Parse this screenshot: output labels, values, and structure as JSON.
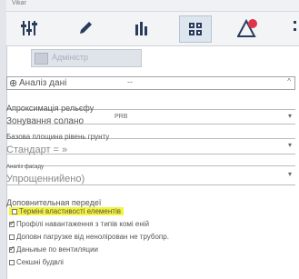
{
  "window": {
    "title": "Vikar"
  },
  "toolbar": {
    "active_index": 3,
    "icons": [
      "sliders-icon",
      "pencil-icon",
      "bar-chart-icon",
      "grid-icon",
      "warning-badge-icon"
    ]
  },
  "banner": {
    "label": "Адміністр"
  },
  "analysis": {
    "value": "Аналіз дані",
    "sub": "--"
  },
  "relief": {
    "label": "Апроксимація рельєфу"
  },
  "zoning": {
    "label": "Зонування солано",
    "value": "PRB"
  },
  "base": {
    "label": "Базова площина рівень грунту"
  },
  "standard": {
    "label": "Стандарт = »"
  },
  "facade": {
    "label": "Аналіз фасаду"
  },
  "simplified": {
    "label": "Упрощенний",
    "value": "ено)"
  },
  "extra": {
    "title": "Доповнительная передеї",
    "items": [
      {
        "label": "Терміні властивості елементів",
        "checked": false,
        "highlighted": true
      },
      {
        "label": "Профілі навантаження з типів комі еній",
        "checked": true
      },
      {
        "label": "Доповн пагрузке від ненолірован не трубопр.",
        "checked": false
      },
      {
        "label": "Даньиые по вентиляции",
        "checked": true
      },
      {
        "label": "Секшні будвлі",
        "checked": false
      }
    ]
  }
}
